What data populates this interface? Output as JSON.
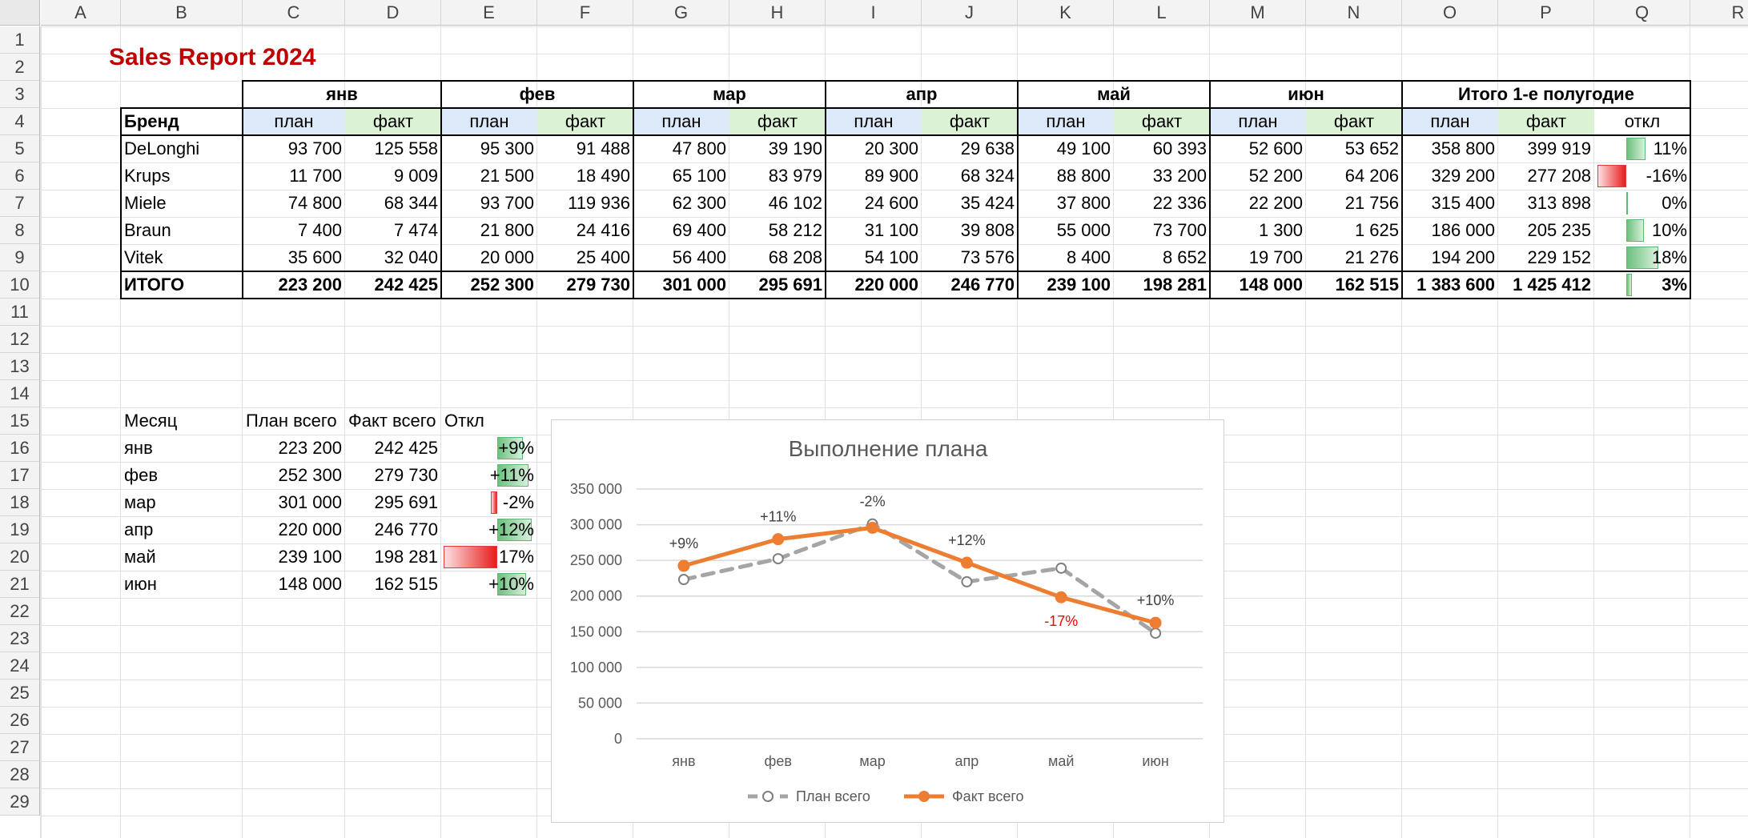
{
  "sheet": {
    "columns": [
      "A",
      "B",
      "C",
      "D",
      "E",
      "F",
      "G",
      "H",
      "I",
      "J",
      "K",
      "L",
      "M",
      "N",
      "O",
      "P",
      "Q",
      "R"
    ],
    "rows": [
      "1",
      "2",
      "3",
      "4",
      "5",
      "6",
      "7",
      "8",
      "9",
      "10",
      "11",
      "12",
      "13",
      "14",
      "15",
      "16",
      "17",
      "18",
      "19",
      "20",
      "21",
      "22",
      "23",
      "24",
      "25",
      "26",
      "27",
      "28",
      "29"
    ]
  },
  "report": {
    "title": "Sales Report 2024",
    "months": [
      "янв",
      "фев",
      "мар",
      "апр",
      "май",
      "июн"
    ],
    "half_year": "Итого 1-е полугодие",
    "brand_header": "Бренд",
    "plan": "план",
    "fact": "факт",
    "dev": "откл",
    "rows": [
      {
        "brand": "DeLonghi",
        "vals": [
          "93 700",
          "125 558",
          "95 300",
          "91 488",
          "47 800",
          "39 190",
          "20 300",
          "29 638",
          "49 100",
          "60 393",
          "52 600",
          "53 652",
          "358 800",
          "399 919"
        ],
        "dev": "11%",
        "dev_value": 11
      },
      {
        "brand": "Krups",
        "vals": [
          "11 700",
          "9 009",
          "21 500",
          "18 490",
          "65 100",
          "83 979",
          "89 900",
          "68 324",
          "88 800",
          "33 200",
          "52 200",
          "64 206",
          "329 200",
          "277 208"
        ],
        "dev": "-16%",
        "dev_value": -16
      },
      {
        "brand": "Miele",
        "vals": [
          "74 800",
          "68 344",
          "93 700",
          "119 936",
          "62 300",
          "46 102",
          "24 600",
          "35 424",
          "37 800",
          "22 336",
          "22 200",
          "21 756",
          "315 400",
          "313 898"
        ],
        "dev": "0%",
        "dev_value": 0
      },
      {
        "brand": "Braun",
        "vals": [
          "7 400",
          "7 474",
          "21 800",
          "24 416",
          "69 400",
          "58 212",
          "31 100",
          "39 808",
          "55 000",
          "73 700",
          "1 300",
          "1 625",
          "186 000",
          "205 235"
        ],
        "dev": "10%",
        "dev_value": 10
      },
      {
        "brand": "Vitek",
        "vals": [
          "35 600",
          "32 040",
          "20 000",
          "25 400",
          "56 400",
          "68 208",
          "54 100",
          "73 576",
          "8 400",
          "8 652",
          "19 700",
          "21 276",
          "194 200",
          "229 152"
        ],
        "dev": "18%",
        "dev_value": 18
      }
    ],
    "total": {
      "brand": "ИТОГО",
      "vals": [
        "223 200",
        "242 425",
        "252 300",
        "279 730",
        "301 000",
        "295 691",
        "220 000",
        "246 770",
        "239 100",
        "198 281",
        "148 000",
        "162 515",
        "1 383 600",
        "1 425 412"
      ],
      "dev": "3%",
      "dev_value": 3
    }
  },
  "summary": {
    "headers": [
      "Месяц",
      "План всего",
      "Факт всего",
      "Откл"
    ],
    "rows": [
      {
        "month": "янв",
        "plan": "223 200",
        "fact": "242 425",
        "dev": "+9%",
        "dev_value": 9
      },
      {
        "month": "фев",
        "plan": "252 300",
        "fact": "279 730",
        "dev": "+11%",
        "dev_value": 11
      },
      {
        "month": "мар",
        "plan": "301 000",
        "fact": "295 691",
        "dev": "-2%",
        "dev_value": -2
      },
      {
        "month": "апр",
        "plan": "220 000",
        "fact": "246 770",
        "dev": "+12%",
        "dev_value": 12
      },
      {
        "month": "май",
        "plan": "239 100",
        "fact": "198 281",
        "dev": "17%",
        "dev_value": -17
      },
      {
        "month": "июн",
        "plan": "148 000",
        "fact": "162 515",
        "dev": "+10%",
        "dev_value": 10
      }
    ]
  },
  "chart_data": {
    "type": "line",
    "title": "Выполнение плана",
    "categories": [
      "янв",
      "фев",
      "мар",
      "апр",
      "май",
      "июн"
    ],
    "ylim": [
      0,
      350000
    ],
    "yticks": [
      "350 000",
      "300 000",
      "250 000",
      "200 000",
      "150 000",
      "100 000",
      "50 000",
      "0"
    ],
    "ytick_values": [
      350000,
      300000,
      250000,
      200000,
      150000,
      100000,
      50000,
      0
    ],
    "grid": true,
    "legend": "bottom",
    "series": [
      {
        "name": "План всего",
        "values": [
          223200,
          252300,
          301000,
          220000,
          239100,
          148000
        ],
        "color": "#a5a5a5",
        "style": "dashed"
      },
      {
        "name": "Факт всего",
        "values": [
          242425,
          279730,
          295691,
          246770,
          198281,
          162515
        ],
        "color": "#ed7d31",
        "style": "solid"
      }
    ],
    "data_labels": [
      "+9%",
      "+11%",
      "-2%",
      "+12%",
      "-17%",
      "+10%"
    ],
    "negative_label_color": "#ff0000"
  }
}
